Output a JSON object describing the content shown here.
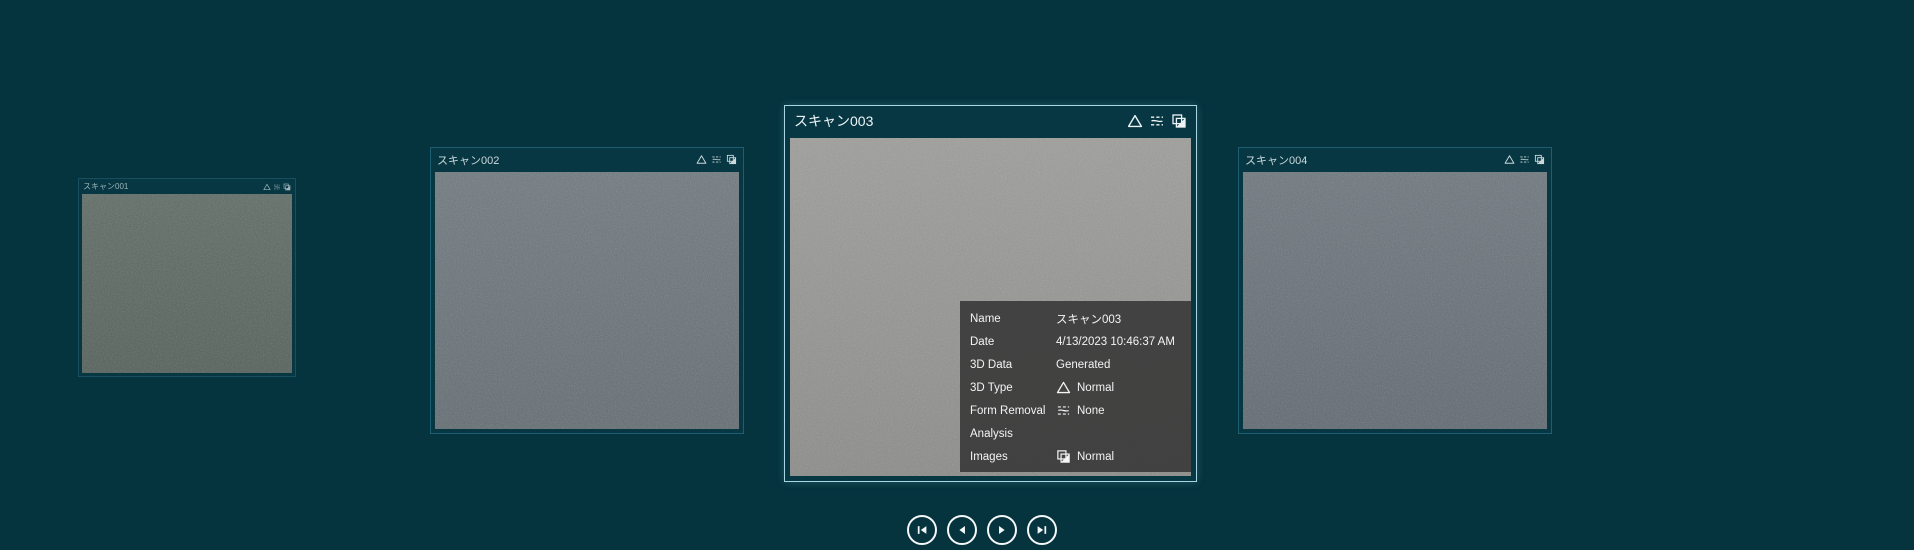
{
  "page": {
    "background_color": "#05333e"
  },
  "carousel": {
    "cards": [
      {
        "title": "スキャン001"
      },
      {
        "title": "スキャン002"
      },
      {
        "title": "スキャン003"
      },
      {
        "title": "スキャン004"
      }
    ],
    "selected_index": 2,
    "card_status_icons": [
      "3d-type-triangle-icon",
      "form-removal-icon",
      "images-icon"
    ]
  },
  "info_panel": {
    "rows": [
      {
        "label": "Name",
        "value": "スキャン003"
      },
      {
        "label": "Date",
        "value": "4/13/2023 10:46:37 AM"
      },
      {
        "label": "3D Data",
        "value": "Generated"
      },
      {
        "label": "3D Type",
        "value": "Normal",
        "icon": "triangle-icon"
      },
      {
        "label": "Form Removal",
        "value": "None",
        "icon": "form-removal-icon"
      },
      {
        "label": "Analysis",
        "value": ""
      },
      {
        "label": "Images",
        "value": "Normal",
        "icon": "images-icon"
      }
    ]
  },
  "navigation": {
    "buttons": [
      {
        "icon": "skip-first-icon"
      },
      {
        "icon": "previous-icon"
      },
      {
        "icon": "next-icon"
      },
      {
        "icon": "skip-last-icon"
      }
    ]
  },
  "colors": {
    "background": "#05333e",
    "card_border": "#1e5e73",
    "selected_card_border": "#a9d6e2",
    "info_panel_background": "#3b3b3b",
    "text_light": "#f4f4f4"
  }
}
